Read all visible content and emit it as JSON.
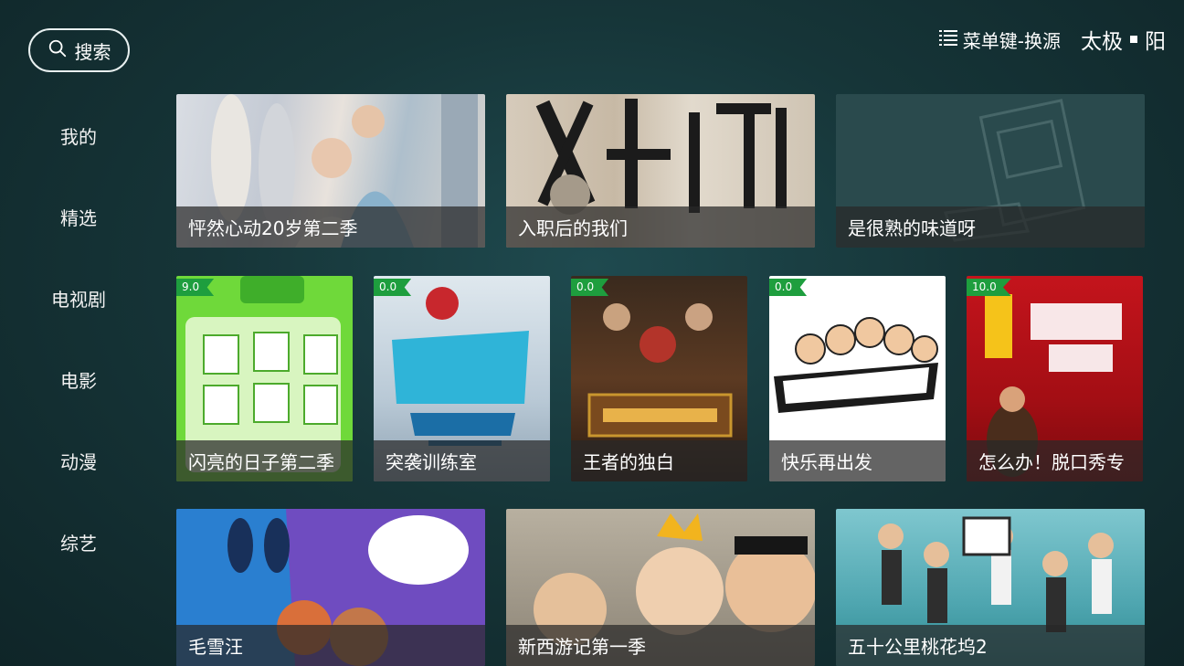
{
  "header": {
    "search_label": "搜索",
    "menu_hint": "菜单键-换源",
    "source_name": "太极",
    "source_sub": "阳"
  },
  "sidebar": {
    "items": [
      {
        "label": "我的"
      },
      {
        "label": "精选"
      },
      {
        "label": "电视剧"
      },
      {
        "label": "电影"
      },
      {
        "label": "动漫"
      },
      {
        "label": "综艺"
      }
    ]
  },
  "rows": {
    "row1": [
      {
        "title": "怦然心动20岁第二季"
      },
      {
        "title": "入职后的我们"
      },
      {
        "title": "是很熟的味道呀"
      }
    ],
    "row2": [
      {
        "title": "闪亮的日子第二季",
        "rating": "9.0"
      },
      {
        "title": "突袭训练室",
        "rating": "0.0"
      },
      {
        "title": "王者的独白",
        "rating": "0.0"
      },
      {
        "title": "快乐再出发",
        "rating": "0.0"
      },
      {
        "title": "怎么办！脱口秀专",
        "rating": "10.0"
      }
    ],
    "row3": [
      {
        "title": "毛雪汪"
      },
      {
        "title": "新西游记第一季"
      },
      {
        "title": "五十公里桃花坞2"
      }
    ]
  },
  "colors": {
    "background": "#163538",
    "badge": "#1e9e3e",
    "caption_bg": "#282828"
  }
}
